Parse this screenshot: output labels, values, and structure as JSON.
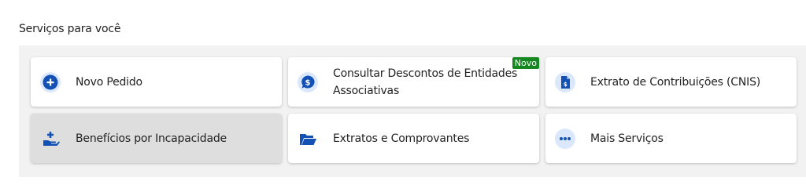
{
  "section": {
    "title": "Serviços para você"
  },
  "services": [
    {
      "label": "Novo Pedido",
      "icon": "plus-circle-icon"
    },
    {
      "label": "Consultar Descontos de Entidades Associativas",
      "icon": "dollar-bubble-icon",
      "badge": "Novo"
    },
    {
      "label": "Extrato de Contribuições (CNIS)",
      "icon": "document-icon"
    },
    {
      "label": "Benefícios por Incapacidade",
      "icon": "hand-plus-icon",
      "state": "hovered"
    },
    {
      "label": "Extratos e Comprovantes",
      "icon": "folder-open-icon"
    },
    {
      "label": "Mais Serviços",
      "icon": "more-dots-icon"
    }
  ],
  "colors": {
    "icon": "#1351b4",
    "icon_bg": "#dbe8fb",
    "badge": "#168821",
    "panel": "#f2f2f2"
  }
}
